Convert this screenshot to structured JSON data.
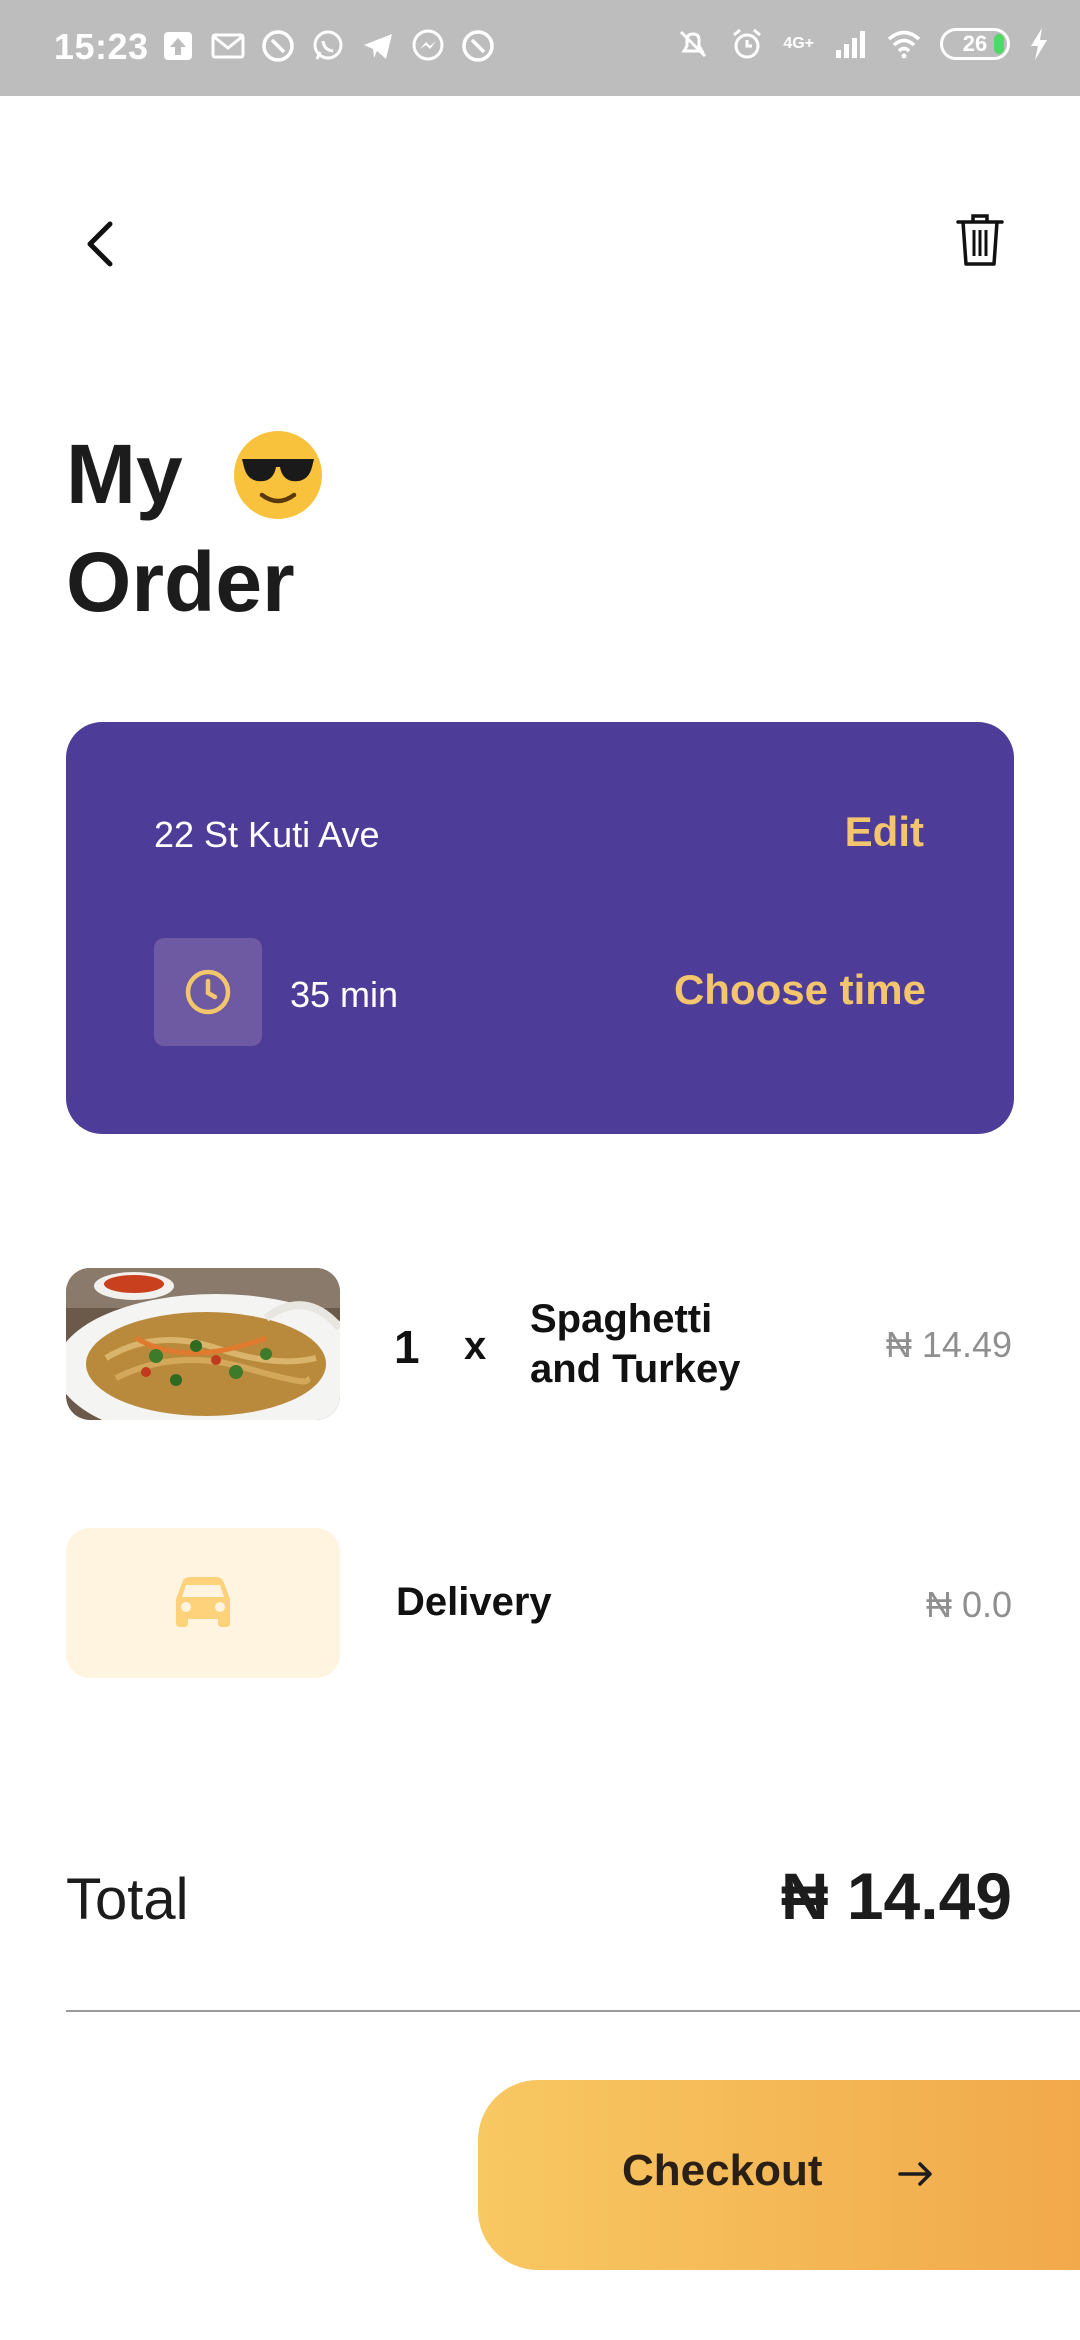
{
  "status_bar": {
    "time": "15:23",
    "battery_level": "26",
    "network_label": "4G+",
    "left_icons": [
      "upload-icon",
      "mail-icon",
      "app-icon",
      "whatsapp-icon",
      "telegram-icon",
      "messenger-icon",
      "app-icon"
    ],
    "right_icons": [
      "mute-icon",
      "alarm-icon",
      "signal-icon",
      "wifi-icon",
      "battery-icon",
      "charging-icon"
    ]
  },
  "header": {
    "back_icon": "chevron-left-icon",
    "delete_icon": "trash-icon",
    "title_line1": "My",
    "title_line2": "Order",
    "title_emoji": "sunglasses-emoji"
  },
  "address_card": {
    "address": "22 St Kuti Ave",
    "edit_label": "Edit",
    "delivery_time": "35 min",
    "choose_time_label": "Choose time",
    "background": "#4e3d98",
    "accent": "#f3c56c"
  },
  "order_items": [
    {
      "quantity": "1",
      "multiplier": "x",
      "name": "Spaghetti and Turkey",
      "price": "₦ 14.49"
    }
  ],
  "delivery": {
    "label": "Delivery",
    "price": "₦ 0.0",
    "icon": "car-icon"
  },
  "total": {
    "label": "Total",
    "value": "₦ 14.49"
  },
  "checkout": {
    "label": "Checkout",
    "icon": "arrow-right-icon",
    "gradient_start": "#f8c862",
    "gradient_end": "#f1a84a"
  }
}
